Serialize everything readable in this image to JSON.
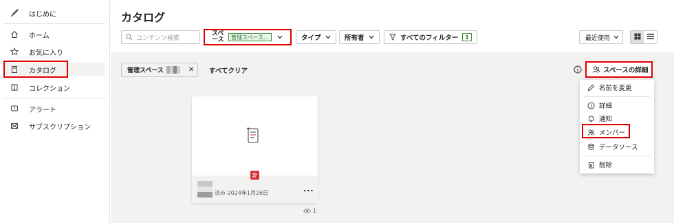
{
  "sidebar": {
    "items": [
      {
        "label": "はじめに",
        "icon": "rocket-icon"
      },
      {
        "label": "ホーム",
        "icon": "home-icon"
      },
      {
        "label": "お気に入り",
        "icon": "star-icon"
      },
      {
        "label": "カタログ",
        "icon": "book-icon",
        "active": true
      },
      {
        "label": "コレクション",
        "icon": "collection-icon"
      },
      {
        "label": "アラート",
        "icon": "alert-icon"
      },
      {
        "label": "サブスクリプション",
        "icon": "mail-icon"
      }
    ]
  },
  "page": {
    "title": "カタログ"
  },
  "toolbar": {
    "search_placeholder": "コンテンツ検索",
    "space_label": "スペース",
    "space_value": "管理スペース...",
    "type_label": "タイプ",
    "owner_label": "所有者",
    "all_filters_label": "すべてのフィルター",
    "all_filters_count": "1",
    "sort_label": "最近使用"
  },
  "filters": {
    "tag_label": "管理スペース",
    "clear_label": "すべてクリア"
  },
  "space_details": {
    "button_label": "スペースの詳細",
    "menu": [
      {
        "label": "名前を変更",
        "icon": "pencil-icon"
      },
      {
        "label": "詳細",
        "icon": "info-icon"
      },
      {
        "label": "通知",
        "icon": "bell-icon"
      },
      {
        "label": "メンバー",
        "icon": "members-icon"
      },
      {
        "label": "データソース",
        "icon": "database-icon"
      },
      {
        "label": "削除",
        "icon": "trash-icon"
      }
    ]
  },
  "card": {
    "meta": "済み 2024年1月26日",
    "more": "...",
    "views": "1"
  },
  "colors": {
    "highlight": "#e00000",
    "accent_green": "#2b7a2b",
    "badge_red": "#d13438"
  }
}
